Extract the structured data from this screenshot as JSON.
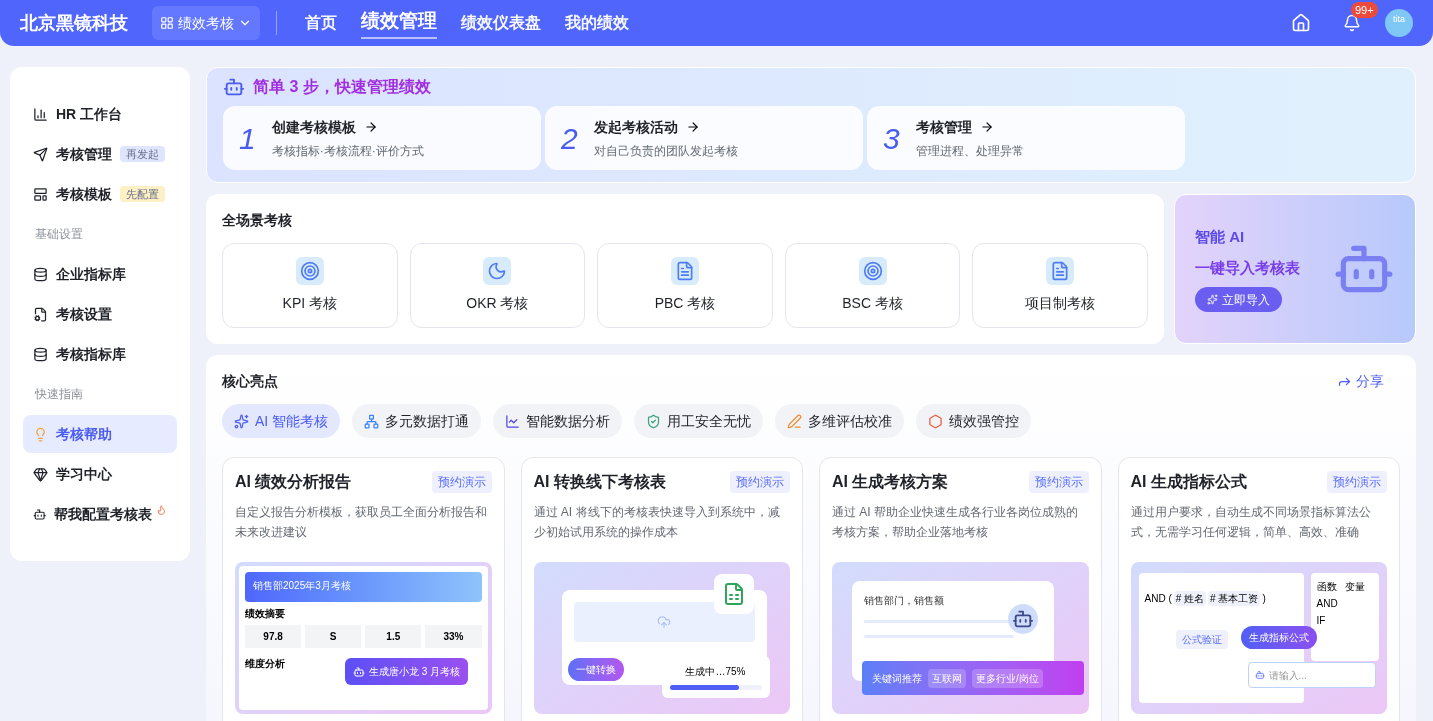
{
  "header": {
    "brand": "北京黑镜科技",
    "module": "绩效考核",
    "nav": [
      {
        "label": "首页",
        "selected": false
      },
      {
        "label": "绩效管理",
        "selected": true
      },
      {
        "label": "绩效仪表盘",
        "selected": false
      },
      {
        "label": "我的绩效",
        "selected": false
      }
    ],
    "notification_count": "99+",
    "avatar": "tita"
  },
  "sidebar": [
    {
      "kind": "item",
      "label": "HR 工作台",
      "selected": false
    },
    {
      "kind": "item",
      "label": "考核管理",
      "selected": false,
      "badge": {
        "text": "再发起",
        "color": "#dfe5ff"
      }
    },
    {
      "kind": "item",
      "label": "考核模板",
      "selected": false,
      "badge": {
        "text": "先配置",
        "color": "#fdf0c4"
      }
    },
    {
      "kind": "section",
      "label": "基础设置"
    },
    {
      "kind": "item",
      "label": "企业指标库",
      "selected": false
    },
    {
      "kind": "item",
      "label": "考核设置",
      "selected": false
    },
    {
      "kind": "item",
      "label": "考核指标库",
      "selected": false
    },
    {
      "kind": "section",
      "label": "快速指南"
    },
    {
      "kind": "item",
      "label": "考核帮助",
      "selected": true
    },
    {
      "kind": "item",
      "label": "学习中心",
      "selected": false
    },
    {
      "kind": "item",
      "label": "帮我配置考核表",
      "selected": false
    }
  ],
  "steps": {
    "title": "简单 **3** 步，快速管理绩效",
    "items": [
      {
        "number": "1",
        "title": "创建考核模板",
        "desc": "考核指标·考核流程·评价方式"
      },
      {
        "number": "2",
        "title": "发起考核活动",
        "desc": "对自己负责的团队发起考核"
      },
      {
        "number": "3",
        "title": "考核管理",
        "desc": "管理进程、处理异常"
      }
    ]
  },
  "scenarios": {
    "title": "全场景考核",
    "items": [
      "KPI 考核",
      "OKR 考核",
      "PBC 考核",
      "BSC 考核",
      "项目制考核"
    ]
  },
  "promo": {
    "line_1": "智能 AI",
    "line_2": "一键导入考核表",
    "button": "立即导入"
  },
  "highlights": {
    "title": "核心亮点",
    "share": "分享",
    "tabs": [
      {
        "label": "AI 智能考核",
        "selected": true
      },
      {
        "label": "多元数据打通",
        "selected": false
      },
      {
        "label": "智能数据分析",
        "selected": false
      },
      {
        "label": "用工安全无忧",
        "selected": false
      },
      {
        "label": "多维评估校准",
        "selected": false
      },
      {
        "label": "绩效强管控",
        "selected": false
      }
    ],
    "cards": [
      {
        "kind": "report",
        "title": "AI 绩效分析报告",
        "badge": "预约演示",
        "desc": "自定义报告分析模板，获取员工全面分析报告和未来改进建议",
        "preview": {
          "heading": "销售部2025年3月考核",
          "section_1": "绩效摘要",
          "stats": [
            "97.8",
            "S",
            "1.5",
            "33%"
          ],
          "section_2": "维度分析",
          "action": "生成唐小龙 3 月考核"
        }
      },
      {
        "kind": "convert",
        "title": "AI 转换线下考核表",
        "badge": "预约演示",
        "desc": "通过 AI 将线下的考核表快速导入到系统中，减少初始试用系统的操作成本",
        "preview": {
          "action": "一键转换",
          "progress_text": "生成中…75%",
          "level": 0.75
        }
      },
      {
        "kind": "plan",
        "title": "AI 生成考核方案",
        "badge": "预约演示",
        "desc": "通过 AI 帮助企业快速生成各行业各岗位成熟的考核方案，帮助企业落地考核",
        "preview": {
          "query": "销售部门，销售额",
          "label": "关键词推荐",
          "chips": [
            "互联网",
            "更多行业/岗位"
          ]
        }
      },
      {
        "kind": "formula",
        "title": "AI 生成指标公式",
        "badge": "预约演示",
        "desc": "通过用户要求，自动生成不同场景指标算法公式，无需学习任何逻辑，简单、高效、准确",
        "preview": {
          "fn": "AND (",
          "args": [
            "# 姓名",
            "# 基本工资"
          ],
          "close": ")",
          "tabs": [
            "函数",
            "变量"
          ],
          "list": [
            "AND",
            "IF"
          ],
          "verify": "公式验证",
          "action": "生成指标公式",
          "placeholder": "请输入..."
        }
      }
    ]
  }
}
